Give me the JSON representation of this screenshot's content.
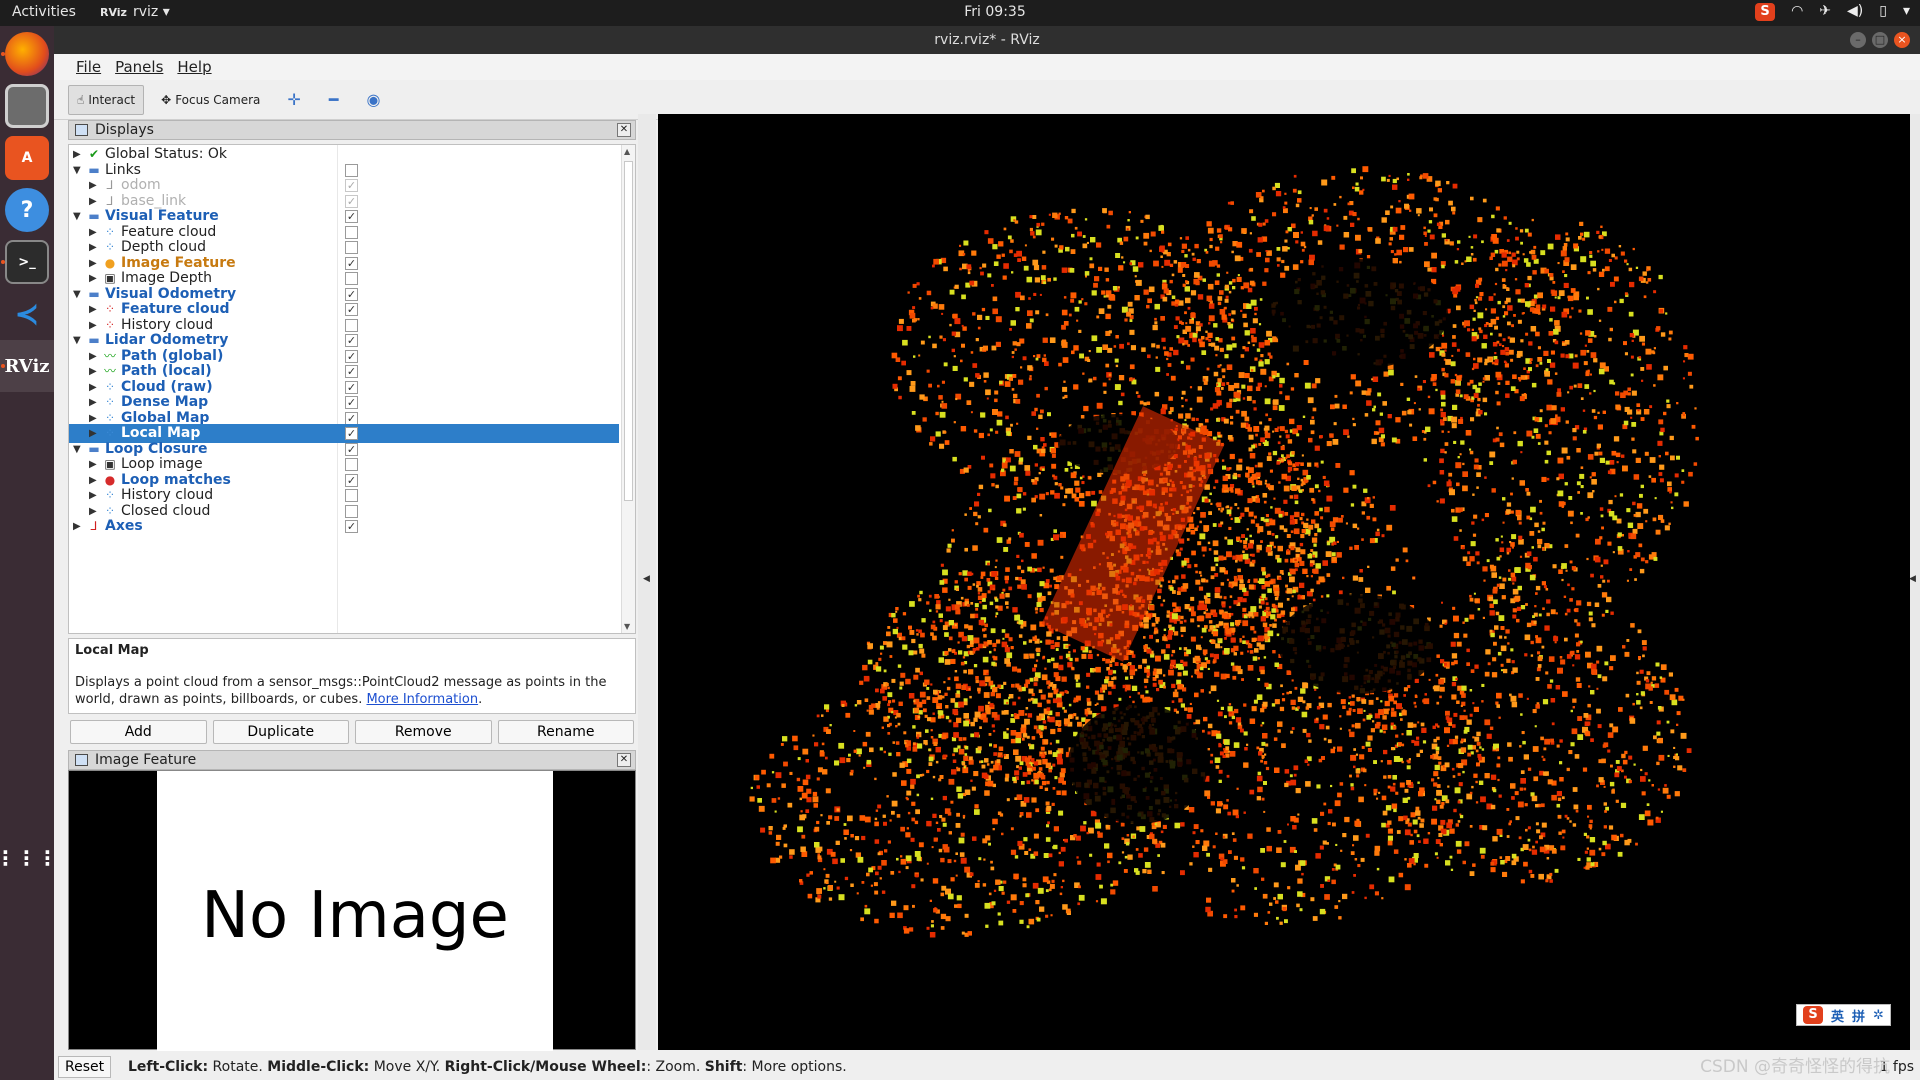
{
  "system": {
    "activities": "Activities",
    "app_name": "rviz",
    "app_logo": "RViz",
    "clock": "Fri 09:35",
    "tray": [
      "wifi-icon",
      "airplane-icon",
      "volume-icon",
      "battery-icon",
      "power-menu-icon"
    ]
  },
  "dock": {
    "items": [
      "firefox",
      "files",
      "software-center",
      "help",
      "terminal",
      "vscode",
      "rviz"
    ]
  },
  "window": {
    "title": "rviz.rviz* - RViz",
    "menu": [
      "File",
      "Panels",
      "Help"
    ],
    "toolbar": {
      "interact": "Interact",
      "focus_camera": "Focus Camera",
      "tool_icons": [
        "move-camera-icon",
        "measure-icon",
        "publish-point-icon"
      ]
    }
  },
  "displays": {
    "title": "Displays",
    "rows": [
      {
        "label": "Global Status: Ok",
        "level": 0,
        "expanded": false,
        "icon": "check",
        "style": "normal",
        "checkbox": null
      },
      {
        "label": "Links",
        "level": 0,
        "expanded": true,
        "icon": "folder",
        "style": "normal",
        "checkbox": "off"
      },
      {
        "label": "odom",
        "level": 1,
        "expanded": false,
        "icon": "axes",
        "style": "dis",
        "checkbox": "dim"
      },
      {
        "label": "base_link",
        "level": 1,
        "expanded": false,
        "icon": "axes",
        "style": "dis",
        "checkbox": "dim"
      },
      {
        "label": "Visual Feature",
        "level": 0,
        "expanded": true,
        "icon": "folder",
        "style": "bold",
        "checkbox": "on"
      },
      {
        "label": "Feature cloud",
        "level": 1,
        "expanded": false,
        "icon": "cloud",
        "style": "normal",
        "checkbox": "off"
      },
      {
        "label": "Depth cloud",
        "level": 1,
        "expanded": false,
        "icon": "cloud",
        "style": "normal",
        "checkbox": "off"
      },
      {
        "label": "Image Feature",
        "level": 1,
        "expanded": false,
        "icon": "warning",
        "style": "warn",
        "checkbox": "on"
      },
      {
        "label": "Image Depth",
        "level": 1,
        "expanded": false,
        "icon": "image",
        "style": "normal",
        "checkbox": "off"
      },
      {
        "label": "Visual Odometry",
        "level": 0,
        "expanded": true,
        "icon": "folder",
        "style": "bold",
        "checkbox": "on"
      },
      {
        "label": "Feature cloud",
        "level": 1,
        "expanded": false,
        "icon": "cloud-red",
        "style": "bold",
        "checkbox": "on"
      },
      {
        "label": "History cloud",
        "level": 1,
        "expanded": false,
        "icon": "cloud-red",
        "style": "normal",
        "checkbox": "off"
      },
      {
        "label": "Lidar Odometry",
        "level": 0,
        "expanded": true,
        "icon": "folder",
        "style": "bold",
        "checkbox": "on"
      },
      {
        "label": "Path (global)",
        "level": 1,
        "expanded": false,
        "icon": "path",
        "style": "bold",
        "checkbox": "on"
      },
      {
        "label": "Path (local)",
        "level": 1,
        "expanded": false,
        "icon": "path",
        "style": "bold",
        "checkbox": "on"
      },
      {
        "label": "Cloud (raw)",
        "level": 1,
        "expanded": false,
        "icon": "cloud",
        "style": "bold",
        "checkbox": "on"
      },
      {
        "label": "Dense Map",
        "level": 1,
        "expanded": false,
        "icon": "cloud",
        "style": "bold",
        "checkbox": "on"
      },
      {
        "label": "Global Map",
        "level": 1,
        "expanded": false,
        "icon": "cloud",
        "style": "bold",
        "checkbox": "on"
      },
      {
        "label": "Local Map",
        "level": 1,
        "expanded": false,
        "icon": "cloud",
        "style": "sel",
        "checkbox": "on"
      },
      {
        "label": "Loop Closure",
        "level": 0,
        "expanded": true,
        "icon": "folder",
        "style": "bold",
        "checkbox": "on"
      },
      {
        "label": "Loop image",
        "level": 1,
        "expanded": false,
        "icon": "image",
        "style": "normal",
        "checkbox": "off"
      },
      {
        "label": "Loop matches",
        "level": 1,
        "expanded": false,
        "icon": "markers",
        "style": "bold",
        "checkbox": "on"
      },
      {
        "label": "History cloud",
        "level": 1,
        "expanded": false,
        "icon": "cloud",
        "style": "normal",
        "checkbox": "off"
      },
      {
        "label": "Closed cloud",
        "level": 1,
        "expanded": false,
        "icon": "cloud",
        "style": "normal",
        "checkbox": "off"
      },
      {
        "label": "Axes",
        "level": 0,
        "expanded": false,
        "icon": "axes-red",
        "style": "bold",
        "checkbox": "on"
      }
    ]
  },
  "description": {
    "title": "Local Map",
    "text": "Displays a point cloud from a sensor_msgs::PointCloud2 message as points in the world, drawn as points, billboards, or cubes.",
    "link": "More Information",
    "trailing": "."
  },
  "buttons": {
    "add": "Add",
    "duplicate": "Duplicate",
    "remove": "Remove",
    "rename": "Rename"
  },
  "image_panel": {
    "title": "Image Feature",
    "no_image": "No Image"
  },
  "statusbar": {
    "reset": "Reset",
    "help": [
      {
        "b": "Left-Click:",
        "t": " Rotate. "
      },
      {
        "b": "Middle-Click:",
        "t": " Move X/Y. "
      },
      {
        "b": "Right-Click/Mouse Wheel:",
        "t": ": Zoom. "
      },
      {
        "b": "Shift",
        "t": ": More options."
      }
    ],
    "fps": "1 fps"
  },
  "ime": {
    "lang": "英",
    "mode": "拼"
  },
  "watermark": "CSDN @奇奇怪怪的得抗",
  "colors": {
    "accent": "#2d7ec9",
    "ubuntu_orange": "#e95420",
    "point_red": "#e52b00",
    "point_orange": "#ff7a0a",
    "point_yellow": "#d8e020"
  }
}
